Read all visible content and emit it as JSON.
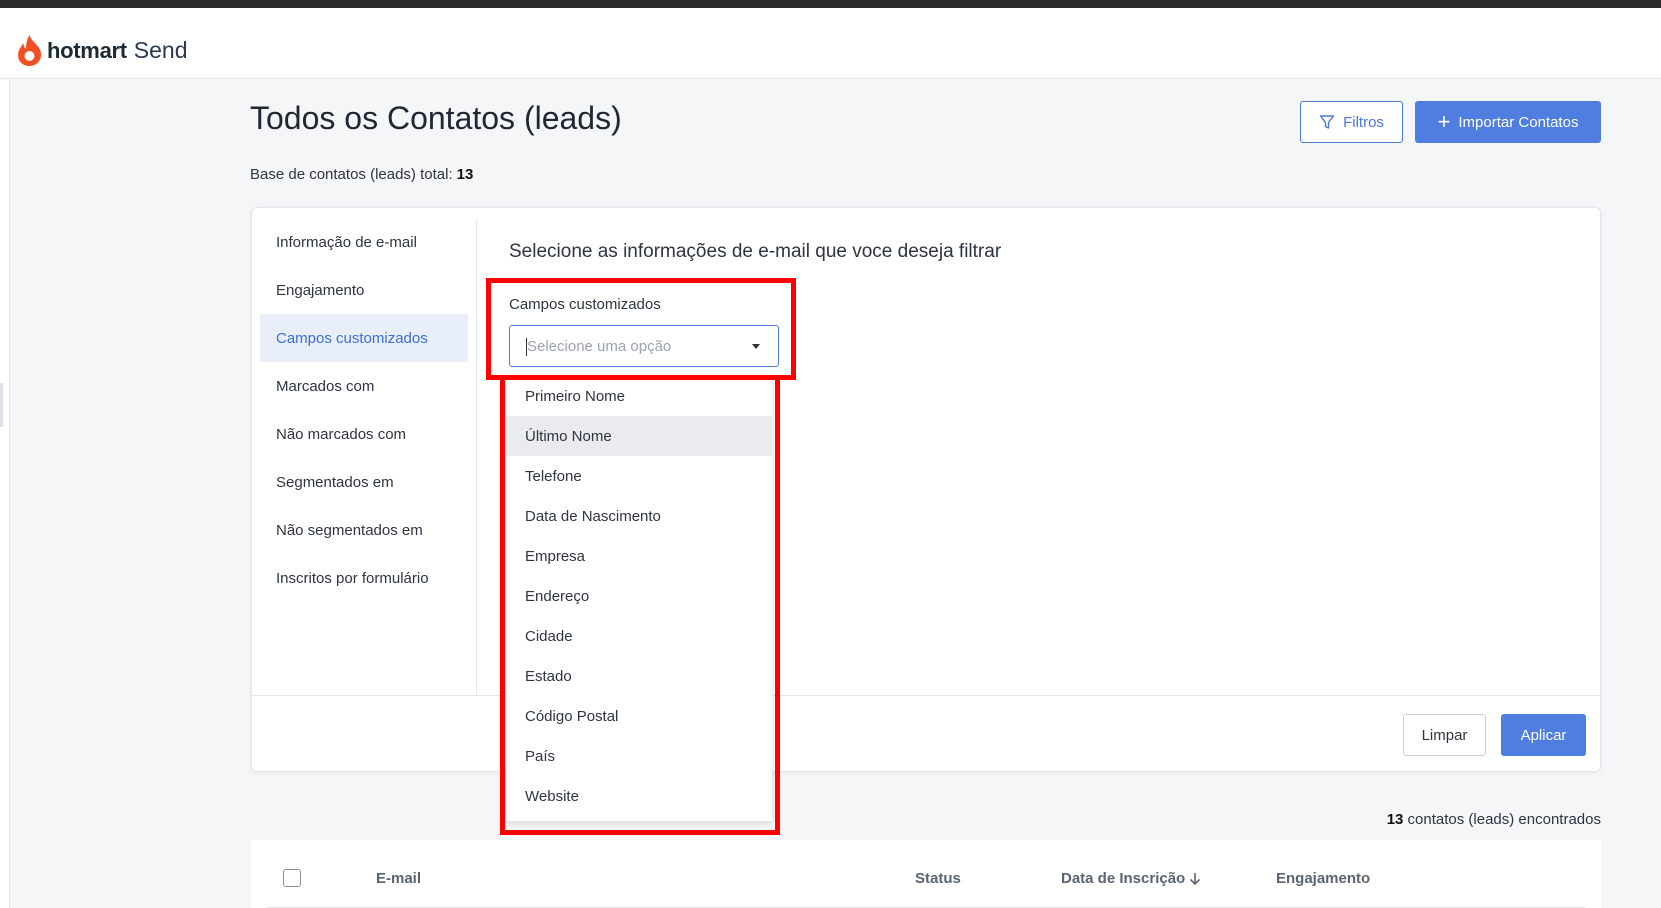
{
  "app": {
    "logo_bold": "hotmart",
    "logo_light": "Send",
    "brand_color": "#F04E23"
  },
  "page": {
    "title": "Todos os Contatos (leads)",
    "total_label": "Base de contatos (leads) total:",
    "total_value": "13"
  },
  "actions": {
    "filtros_label": "Filtros",
    "importar_label": "Importar Contatos"
  },
  "filter_panel": {
    "heading": "Selecione as informações de e-mail que voce deseja filtrar",
    "menu": [
      "Informação de e-mail",
      "Engajamento",
      "Campos customizados",
      "Marcados com",
      "Não marcados com",
      "Segmentados em",
      "Não segmentados em",
      "Inscritos por formulário"
    ],
    "active_menu": "Campos customizados",
    "field_label": "Campos customizados",
    "select_placeholder": "Selecione uma opção",
    "options": [
      "Primeiro Nome",
      "Último Nome",
      "Telefone",
      "Data de Nascimento",
      "Empresa",
      "Endereço",
      "Cidade",
      "Estado",
      "Código Postal",
      "País",
      "Website"
    ],
    "hovered_option": "Último Nome",
    "clear_label": "Limpar",
    "apply_label": "Aplicar"
  },
  "results": {
    "count": "13",
    "count_suffix": "contatos (leads) encontrados"
  },
  "table": {
    "columns": [
      "E-mail",
      "Status",
      "Data de Inscrição",
      "Engajamento"
    ]
  },
  "colors": {
    "accent": "#4F7DE0",
    "highlight": "#FF0000"
  }
}
